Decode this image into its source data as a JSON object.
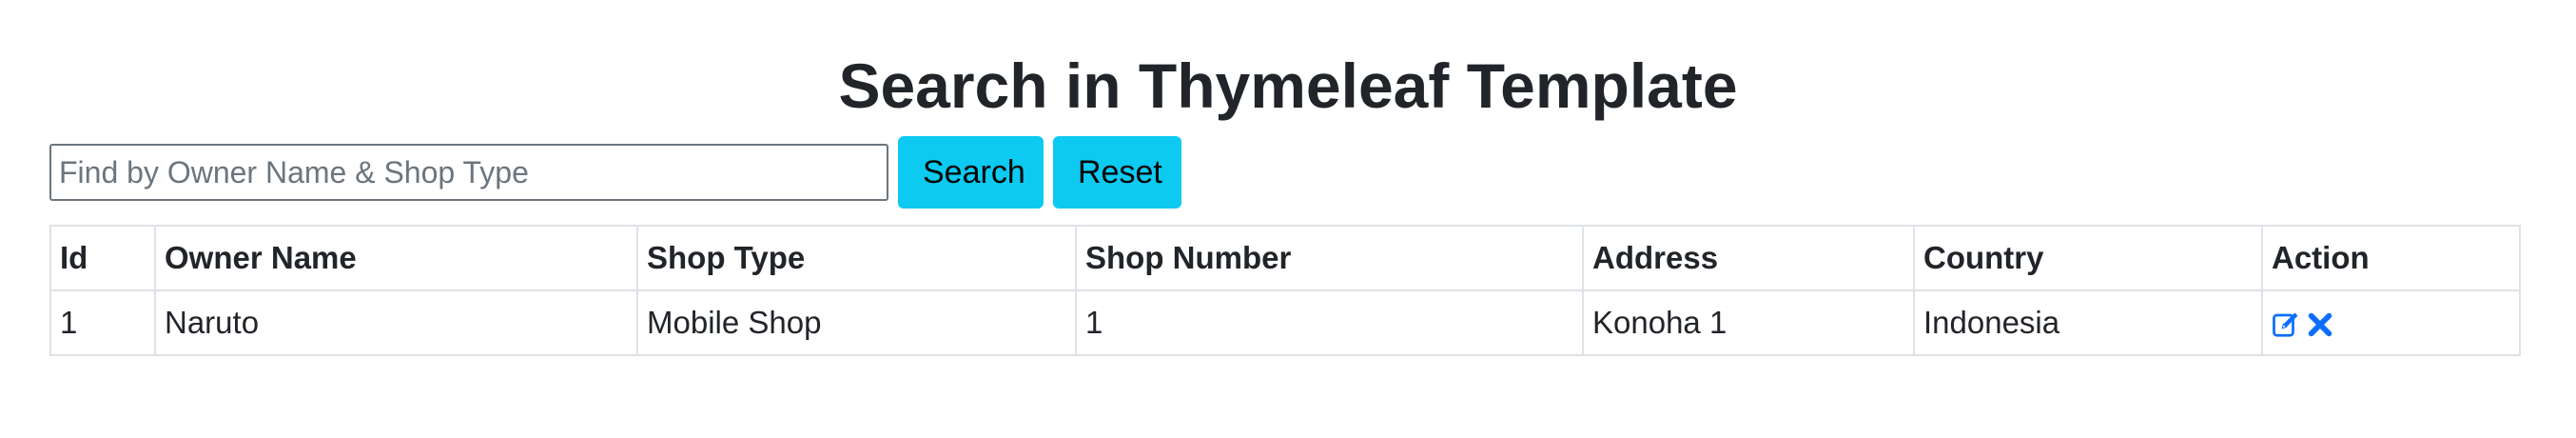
{
  "page": {
    "title": "Search in Thymeleaf Template"
  },
  "search": {
    "placeholder": "Find by Owner Name & Shop Type",
    "value": "",
    "search_label": "Search",
    "reset_label": "Reset"
  },
  "table": {
    "headers": {
      "id": "Id",
      "owner_name": "Owner Name",
      "shop_type": "Shop Type",
      "shop_number": "Shop Number",
      "address": "Address",
      "country": "Country",
      "action": "Action"
    },
    "rows": [
      {
        "id": "1",
        "owner_name": "Naruto",
        "shop_type": "Mobile Shop",
        "shop_number": "1",
        "address": "Konoha 1",
        "country": "Indonesia",
        "actions": [
          "edit-icon",
          "delete-icon"
        ]
      }
    ]
  },
  "colors": {
    "button_bg": "#0dcaf0",
    "icon_color": "#0d6efd",
    "border": "#dee2e6",
    "text": "#212529"
  }
}
